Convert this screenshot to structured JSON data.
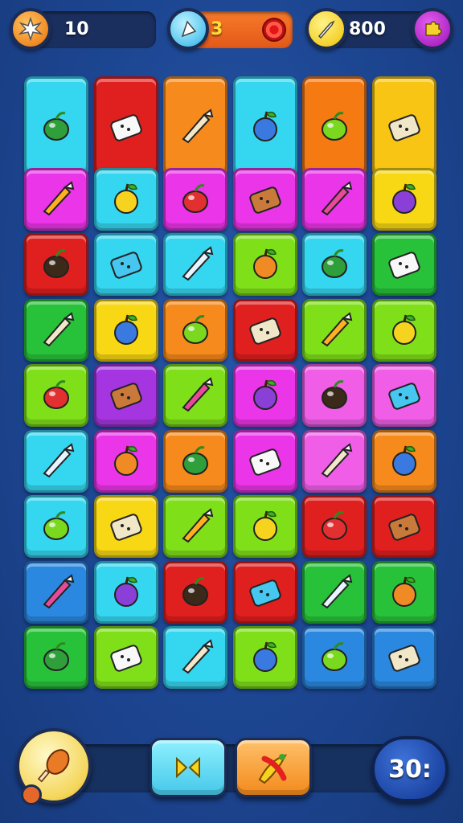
{
  "hud": {
    "left_counter": {
      "value": "10",
      "icon": "star-burst-icon",
      "color": "#f08a24"
    },
    "center_counter": {
      "value": "3",
      "icon": "pennant-icon",
      "bar_color": "#f26a1f",
      "end_icon": "target-icon"
    },
    "right_counter": {
      "value": "800",
      "icon": "sword-icon",
      "color": "#f4d12b",
      "end_icon": "puzzle-icon"
    }
  },
  "board": {
    "rows": 9,
    "cols": 6,
    "tiles": [
      {
        "color": "#35d6f0",
        "icon": "grape-icon"
      },
      {
        "color": "#e01f1f",
        "icon": "sprout-icon"
      },
      {
        "color": "#f78a1c",
        "icon": "ice-cream-cone-icon"
      },
      {
        "color": "#35d6f0",
        "icon": "mirror-icon"
      },
      {
        "color": "#f57a12",
        "icon": "lemon-icon"
      },
      {
        "color": "#f8c514",
        "icon": "ice-pop-icon"
      },
      {
        "color": "#ea35e8",
        "icon": "cracker-icon"
      },
      {
        "color": "#35d6f0",
        "icon": "chocolate-bar-icon"
      },
      {
        "color": "#ea35e8",
        "icon": "spoon-icon"
      },
      {
        "color": "#ea35e8",
        "icon": "onion-icon"
      },
      {
        "color": "#ea35e8",
        "icon": "radish-icon"
      },
      {
        "color": "#f8d814",
        "icon": "bun-icon"
      },
      {
        "color": "#e01f1f",
        "icon": "crossed-arrows-icon"
      },
      {
        "color": "#35d6f0",
        "icon": "drumstick-icon"
      },
      {
        "color": "#35d6f0",
        "icon": "cracker-blue-icon"
      },
      {
        "color": "#7fe01a",
        "icon": "mango-icon"
      },
      {
        "color": "#35d6f0",
        "icon": "blue-fruit-icon"
      },
      {
        "color": "#28c23a",
        "icon": "leaf-bar-icon"
      },
      {
        "color": "#28c23a",
        "icon": "lemon-wedge-icon"
      },
      {
        "color": "#f8d814",
        "icon": "tomato-icon"
      },
      {
        "color": "#f78a1c",
        "icon": "crossed-blades-icon"
      },
      {
        "color": "#e01f1f",
        "icon": "pumpkin-icon"
      },
      {
        "color": "#7fe01a",
        "icon": "fish-icon"
      },
      {
        "color": "#7fe01a",
        "icon": "beet-icon"
      },
      {
        "color": "#7fe01a",
        "icon": "carrot-icon"
      },
      {
        "color": "#a535e0",
        "icon": "crayon-icon"
      },
      {
        "color": "#7fe01a",
        "icon": "orange-icon"
      },
      {
        "color": "#ea35e8",
        "icon": "plum-icon"
      },
      {
        "color": "#f05ee8",
        "icon": "spoon-white-icon"
      },
      {
        "color": "#f05ee8",
        "icon": "leaf-white-icon"
      },
      {
        "color": "#35d6f0",
        "icon": "heart-fruit-icon"
      },
      {
        "color": "#ea35e8",
        "icon": "strawberry-icon"
      },
      {
        "color": "#f78a1c",
        "icon": "bear-face-icon"
      },
      {
        "color": "#ea35e8",
        "icon": "cookie-icon"
      },
      {
        "color": "#f05ee8",
        "icon": "rings-icon"
      },
      {
        "color": "#f78a1c",
        "icon": "cloud-cat-icon"
      },
      {
        "color": "#35d6f0",
        "icon": "pacifier-icon"
      },
      {
        "color": "#f8d814",
        "icon": "clover-icon"
      },
      {
        "color": "#7fe01a",
        "icon": "garlic-icon"
      },
      {
        "color": "#7fe01a",
        "icon": "plum-red-icon"
      },
      {
        "color": "#e01f1f",
        "icon": "pumpkin-small-icon"
      },
      {
        "color": "#e01f1f",
        "icon": "cookie-dark-icon"
      },
      {
        "color": "#2a88e0",
        "icon": "comb-icon"
      },
      {
        "color": "#35d6f0",
        "icon": "stick-icon"
      },
      {
        "color": "#e01f1f",
        "icon": "dumpling-icon"
      },
      {
        "color": "#e01f1f",
        "icon": "apple-icon"
      },
      {
        "color": "#28c23a",
        "icon": "pear-icon"
      },
      {
        "color": "#28c23a",
        "icon": "nut-icon"
      },
      {
        "color": "#28c23a",
        "icon": "pepper-green-icon"
      },
      {
        "color": "#7fe01a",
        "icon": "bulb-icon"
      },
      {
        "color": "#35d6f0",
        "icon": "chili-icon"
      },
      {
        "color": "#7fe01a",
        "icon": "wand-icon"
      },
      {
        "color": "#2a88e0",
        "icon": "saw-icon"
      },
      {
        "color": "#2a88e0",
        "icon": "shell-icon"
      }
    ]
  },
  "footer": {
    "booster_icon": "drumstick-orange-icon",
    "swap_button_icon": "swap-arrows-icon",
    "swap_color": "#4fd6ef",
    "powerup_icon": "chili-powerup-icon",
    "powerup_color": "#f89a22",
    "timer": "30:"
  }
}
